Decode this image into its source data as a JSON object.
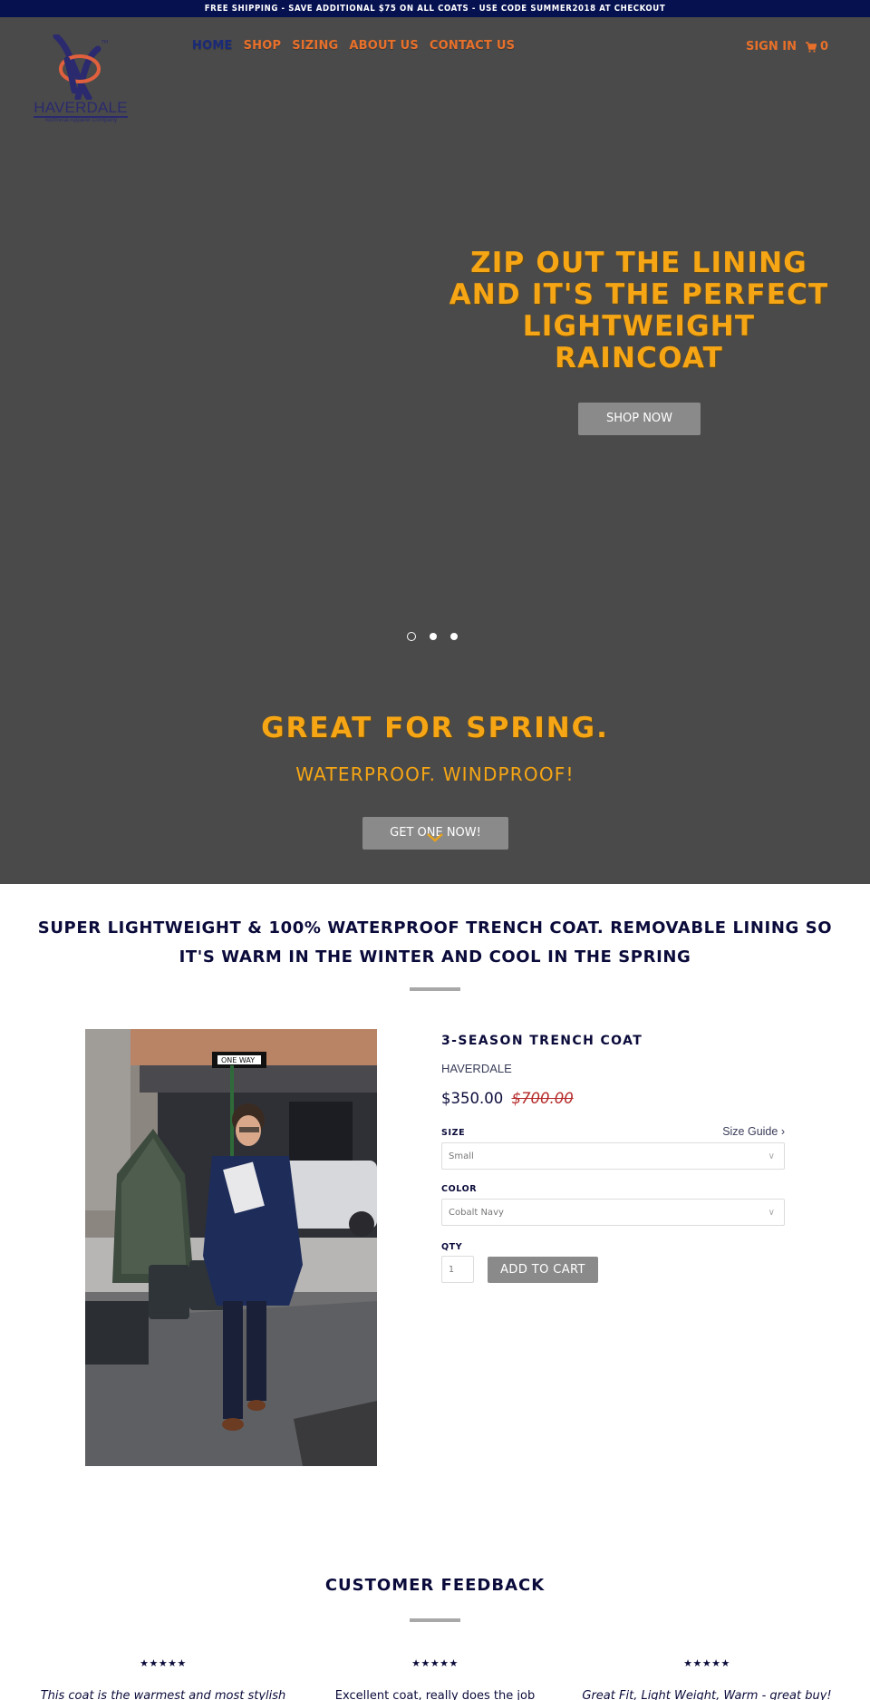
{
  "announcement": "FREE SHIPPING - SAVE ADDITIONAL $75 ON ALL COATS - USE CODE SUMMER2018 AT CHECKOUT",
  "brand": {
    "name": "HAVERDALE",
    "tagline": "Technical Apparel Company",
    "trademark": "TM",
    "colors": {
      "navy": "#2b2a6e",
      "coral": "#e0603e"
    }
  },
  "nav": {
    "items": [
      {
        "label": "HOME",
        "active": true
      },
      {
        "label": "SHOP",
        "active": false
      },
      {
        "label": "SIZING",
        "active": false
      },
      {
        "label": "ABOUT US",
        "active": false
      },
      {
        "label": "CONTACT US",
        "active": false
      }
    ],
    "sign_in": "SIGN IN",
    "cart_icon": "shopping-cart-icon",
    "cart_count": "0"
  },
  "hero": {
    "slide_heading": "ZIP OUT THE LINING AND IT'S THE PERFECT LIGHTWEIGHT RAINCOAT",
    "slide_button": "SHOP NOW",
    "slides_total": 3,
    "active_slide": 1,
    "section_heading": "GREAT FOR SPRING.",
    "section_subheading": "WATERPROOF. WINDPROOF!",
    "section_button": "GET ONE NOW!",
    "scroll_icon": "chevron-down-icon"
  },
  "intro": {
    "heading": "SUPER LIGHTWEIGHT & 100% WATERPROOF TRENCH COAT. REMOVABLE LINING SO IT'S WARM IN THE WINTER AND COOL IN THE SPRING"
  },
  "product": {
    "image_alt": "Man in navy trench coat walking on snowy city street",
    "sign_text": "ONE WAY",
    "title": "3-SEASON TRENCH COAT",
    "vendor": "HAVERDALE",
    "price": "$350.00",
    "compare_at_price": "$700.00",
    "size_label": "SIZE",
    "size_guide": "Size Guide",
    "size_value": "Small",
    "color_label": "COLOR",
    "color_value": "Cobalt Navy",
    "qty_label": "QTY",
    "qty_value": "1",
    "add_to_cart": "ADD TO CART"
  },
  "feedback": {
    "heading": "CUSTOMER FEEDBACK",
    "reviews": [
      {
        "stars": "★★★★★",
        "rating": 5,
        "text": "This coat is the warmest and most stylish",
        "italic": true
      },
      {
        "stars": "★★★★★",
        "rating": 5,
        "text": "Excellent coat, really does the job",
        "italic": false
      },
      {
        "stars": "★★★★★",
        "rating": 5,
        "text": "Great Fit, Light Weight, Warm - great buy!",
        "italic": true
      }
    ]
  }
}
